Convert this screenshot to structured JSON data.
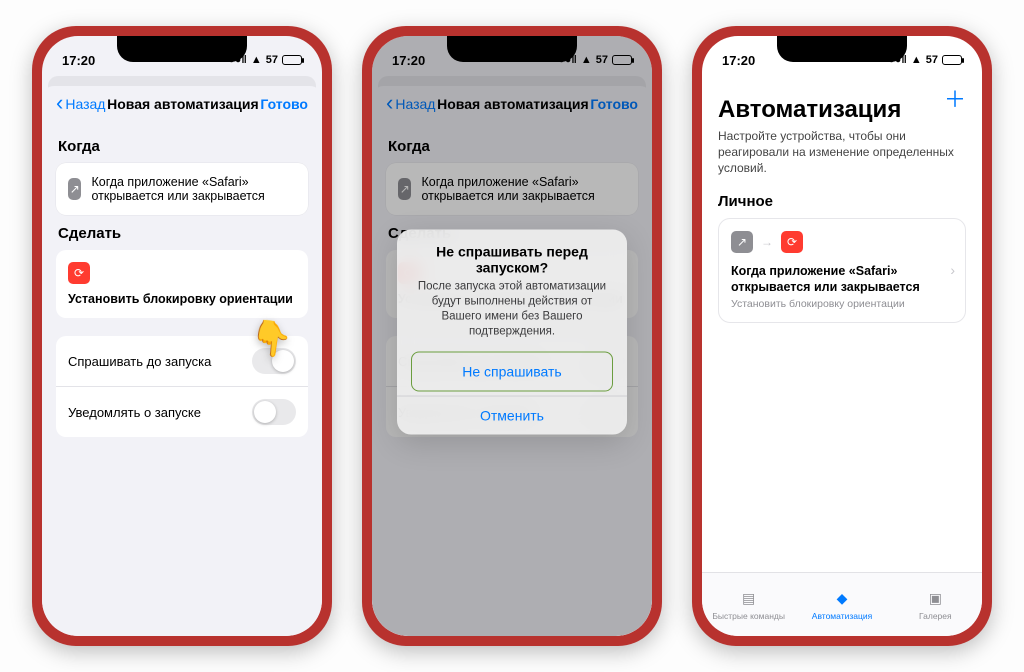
{
  "status": {
    "time": "17:20",
    "battery": "57"
  },
  "nav": {
    "back": "Назад",
    "title": "Новая автоматизация",
    "done": "Готово"
  },
  "section": {
    "when": "Когда",
    "do": "Сделать"
  },
  "when_card": "Когда приложение «Safari» открывается или закрывается",
  "do_card": "Установить блокировку ориентации",
  "toggles": {
    "ask": "Спрашивать до запуска",
    "notify": "Уведомлять о запуске"
  },
  "alert": {
    "title": "Не спрашивать перед запуском?",
    "body": "После запуска этой автоматизации будут выполнены действия от Вашего имени без Вашего подтверждения.",
    "confirm": "Не спрашивать",
    "cancel": "Отменить"
  },
  "p3": {
    "title": "Автоматизация",
    "sub": "Настройте устройства, чтобы они реагировали на изменение определенных условий.",
    "section": "Личное",
    "card_title": "Когда приложение «Safari» открывается или закрывается",
    "card_sub": "Установить блокировку ориентации"
  },
  "tabs": {
    "shortcuts": "Быстрые команды",
    "automation": "Автоматизация",
    "gallery": "Галерея"
  }
}
